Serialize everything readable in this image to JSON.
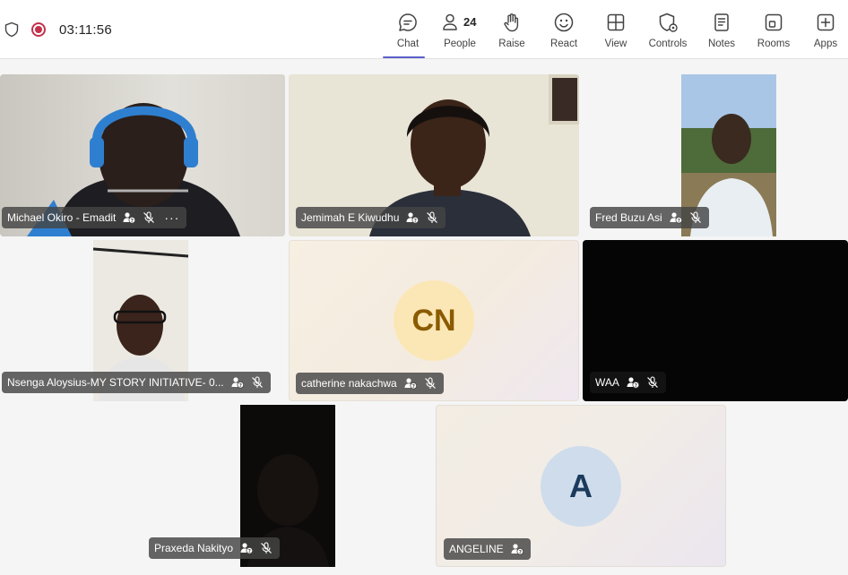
{
  "meeting": {
    "timer": "03:11:56"
  },
  "toolbar": [
    {
      "label": "Chat",
      "icon": "chat-icon",
      "active": true
    },
    {
      "label": "People",
      "icon": "people-icon",
      "count": "24"
    },
    {
      "label": "Raise",
      "icon": "raise-hand-icon"
    },
    {
      "label": "React",
      "icon": "react-smiley-icon"
    },
    {
      "label": "View",
      "icon": "view-grid-icon"
    },
    {
      "label": "Controls",
      "icon": "controls-shield-icon"
    },
    {
      "label": "Notes",
      "icon": "notes-icon"
    },
    {
      "label": "Rooms",
      "icon": "rooms-icon"
    },
    {
      "label": "Apps",
      "icon": "apps-add-icon"
    }
  ],
  "participants": [
    {
      "name": "Michael Okiro - Emadit",
      "video": true,
      "more": "···"
    },
    {
      "name": "Jemimah E Kiwudhu",
      "video": true
    },
    {
      "name": "Fred Buzu Asi",
      "video": true
    },
    {
      "name": "Nsenga Aloysius-MY STORY INITIATIVE- 0...",
      "video": true
    },
    {
      "name": "catherine nakachwa",
      "video": false,
      "initials": "CN",
      "avatar_bg": "#fbe7b5",
      "avatar_fg": "#8a5b00"
    },
    {
      "name": "WAA",
      "video": false,
      "dark": true
    },
    {
      "name": "Praxeda Nakityo",
      "video": true
    },
    {
      "name": "ANGELINE",
      "video": false,
      "initials": "A",
      "avatar_bg": "#cfdcec",
      "avatar_fg": "#1b3a5c"
    }
  ],
  "colors": {
    "accent": "#5b5fc7",
    "record": "#c4314b",
    "namebar": "#444444"
  }
}
